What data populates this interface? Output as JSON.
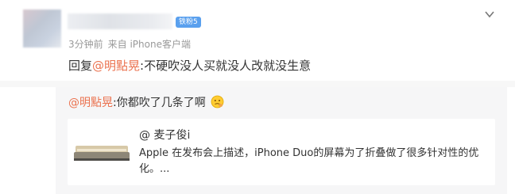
{
  "post": {
    "badge": "铁粉5",
    "time": "3分钟前",
    "source": "来自 iPhone客户端",
    "reply_prefix": "回复",
    "reply_mention": "@明點晃",
    "reply_text": ":不硬吹没人买就没人改就没生意"
  },
  "sub_comment": {
    "mention": "@明點晃",
    "text": ":你都吹了几条了啊",
    "emoji_icon": "thinking-face-emoji"
  },
  "card": {
    "author": "@ 麦子俊i",
    "text": "Apple 在发布会上描述，iPhone Duo的屏幕为了折叠做了很多针对性的优化。..."
  }
}
